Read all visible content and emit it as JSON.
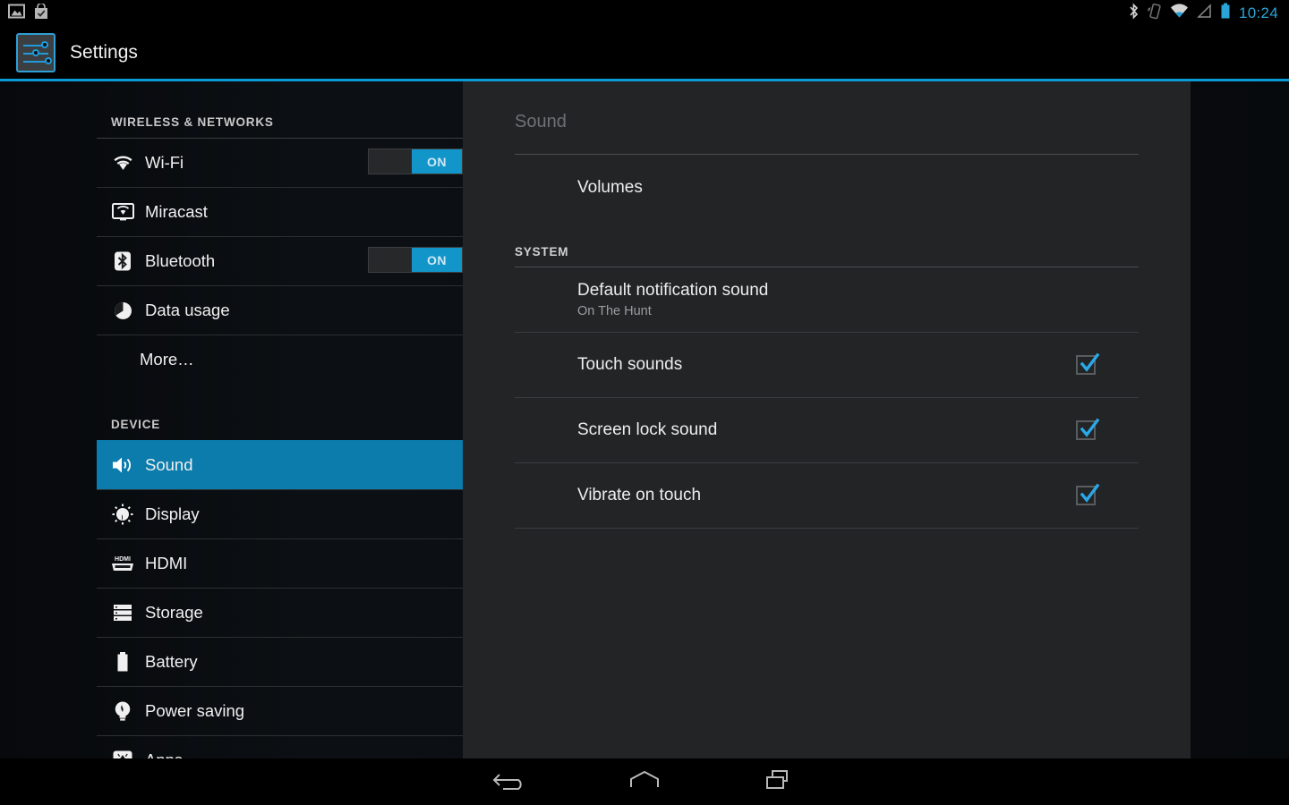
{
  "statusbar": {
    "notifications": [
      {
        "icon": "gallery-image-icon"
      },
      {
        "icon": "app-update-bag-icon"
      }
    ],
    "system_icons": [
      {
        "icon": "bluetooth-icon"
      },
      {
        "icon": "vibrate-icon"
      },
      {
        "icon": "wifi-icon"
      },
      {
        "icon": "signal-icon"
      },
      {
        "icon": "battery-icon"
      }
    ],
    "clock": "10:24"
  },
  "actionbar": {
    "icon": "settings-sliders-icon",
    "title": "Settings",
    "accent_color": "#0a9bd6"
  },
  "sidebar": {
    "sections": [
      {
        "header": "WIRELESS & NETWORKS",
        "items": [
          {
            "label": "Wi-Fi",
            "icon": "wifi-icon",
            "toggle": "ON"
          },
          {
            "label": "Miracast",
            "icon": "miracast-icon"
          },
          {
            "label": "Bluetooth",
            "icon": "bluetooth-icon",
            "toggle": "ON"
          },
          {
            "label": "Data usage",
            "icon": "data-usage-icon"
          },
          {
            "label": "More…",
            "icon": null
          }
        ]
      },
      {
        "header": "DEVICE",
        "items": [
          {
            "label": "Sound",
            "icon": "sound-speaker-icon",
            "selected": true
          },
          {
            "label": "Display",
            "icon": "display-brightness-icon"
          },
          {
            "label": "HDMI",
            "icon": "hdmi-icon"
          },
          {
            "label": "Storage",
            "icon": "storage-icon"
          },
          {
            "label": "Battery",
            "icon": "battery-icon"
          },
          {
            "label": "Power saving",
            "icon": "power-saving-bulb-icon"
          },
          {
            "label": "Apps",
            "icon": "apps-android-icon"
          }
        ]
      }
    ],
    "selected_color": "#0b7cac"
  },
  "content": {
    "title": "Sound",
    "rows": [
      {
        "label": "Volumes",
        "type": "link"
      }
    ],
    "section": {
      "header": "SYSTEM",
      "rows": [
        {
          "label": "Default notification sound",
          "sublabel": "On The Hunt",
          "type": "link"
        },
        {
          "label": "Touch sounds",
          "type": "checkbox",
          "checked": true
        },
        {
          "label": "Screen lock sound",
          "type": "checkbox",
          "checked": true
        },
        {
          "label": "Vibrate on touch",
          "type": "checkbox",
          "checked": true
        }
      ]
    },
    "checkbox_color": "#2aa8e8"
  },
  "navbar": {
    "buttons": [
      {
        "name": "back",
        "icon": "back-arrow-icon"
      },
      {
        "name": "home",
        "icon": "home-icon"
      },
      {
        "name": "recents",
        "icon": "recents-icon"
      }
    ]
  }
}
